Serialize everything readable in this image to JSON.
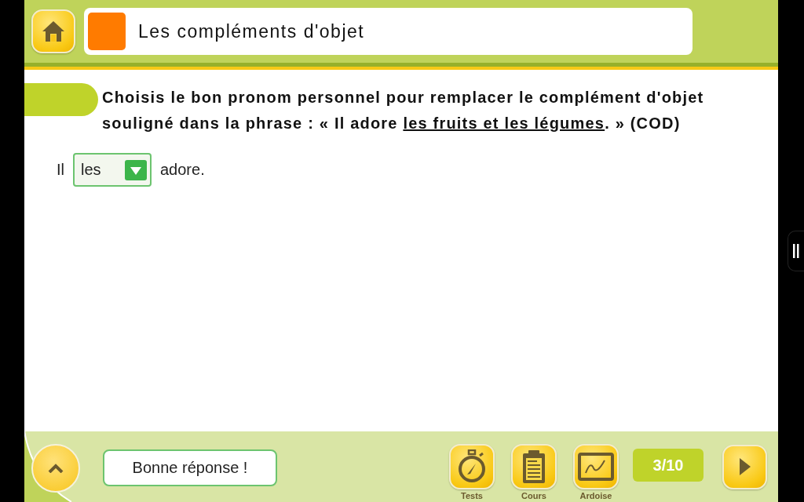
{
  "header": {
    "title": "Les compléments d'objet"
  },
  "instruction": {
    "before": "Choisis le bon pronom personnel pour remplacer le complément d'objet souligné dans la phrase : « Il adore ",
    "underlined": "les fruits et les légumes",
    "after": ". » (COD)"
  },
  "answer": {
    "prefix": "Il",
    "select_value": "les",
    "suffix": "adore."
  },
  "footer": {
    "feedback": "Bonne réponse !",
    "tools": [
      {
        "label": "Tests",
        "kind": "stopwatch"
      },
      {
        "label": "Cours",
        "kind": "clipboard"
      },
      {
        "label": "Ardoise",
        "kind": "slate"
      }
    ],
    "counter": "3/10"
  }
}
